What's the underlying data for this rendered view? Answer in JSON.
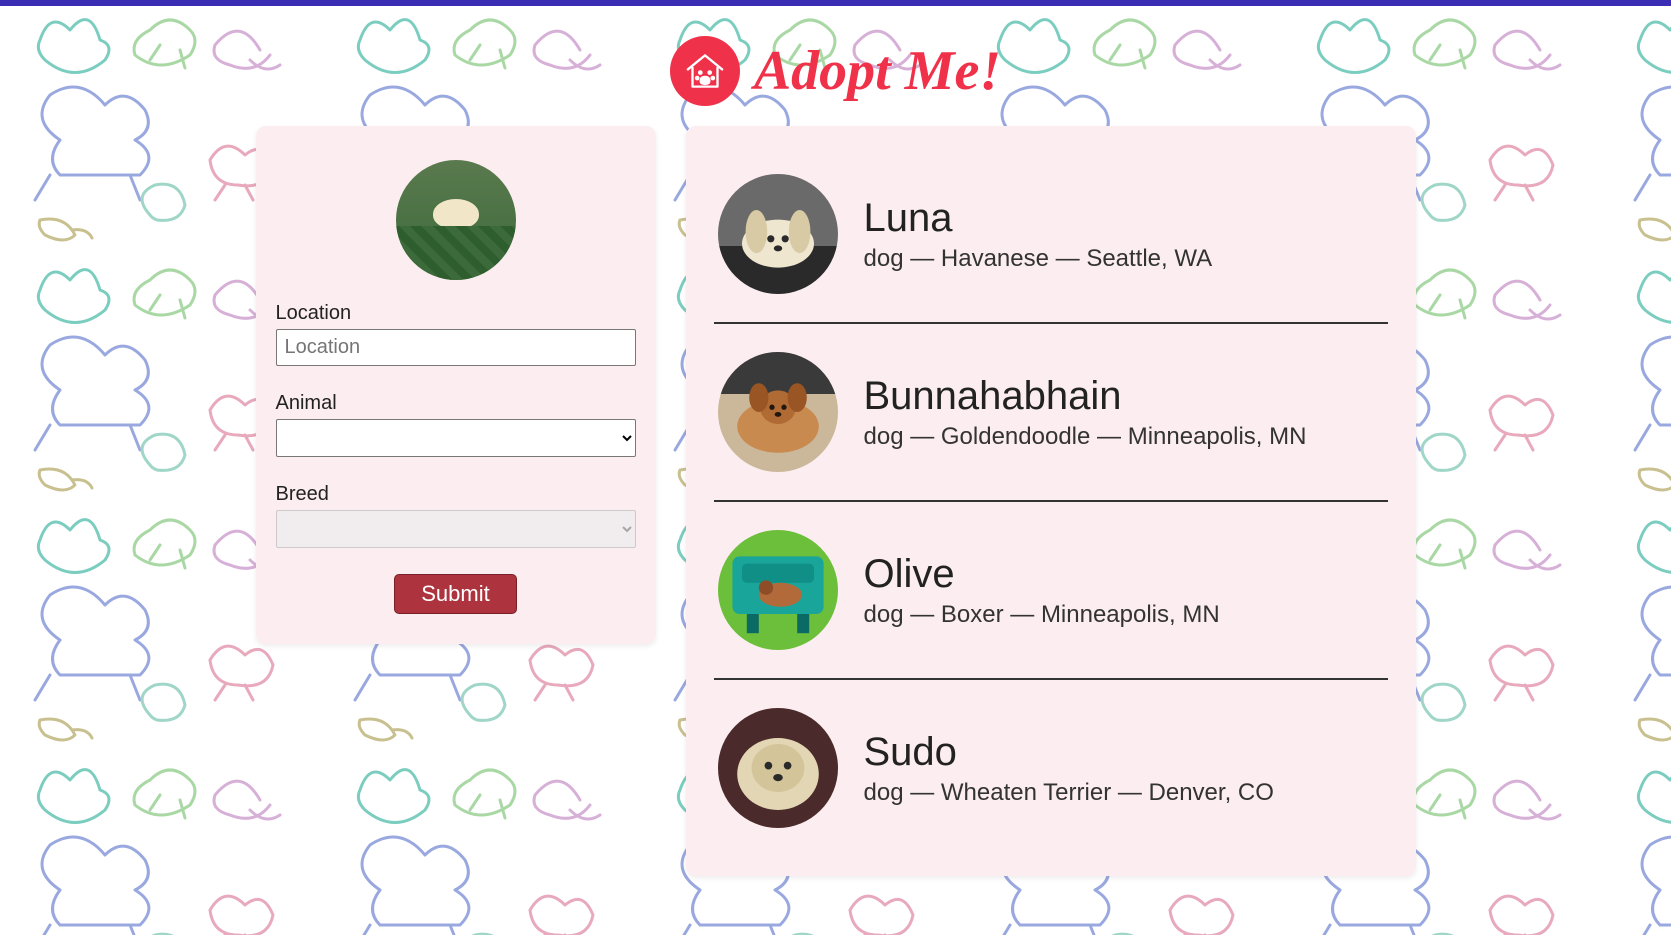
{
  "header": {
    "title": "Adopt Me!"
  },
  "search": {
    "location_label": "Location",
    "location_placeholder": "Location",
    "location_value": "",
    "animal_label": "Animal",
    "animal_value": "",
    "breed_label": "Breed",
    "breed_value": "",
    "submit_label": "Submit"
  },
  "results": [
    {
      "name": "Luna",
      "animal": "dog",
      "breed": "Havanese",
      "location": "Seattle, WA"
    },
    {
      "name": "Bunnahabhain",
      "animal": "dog",
      "breed": "Goldendoodle",
      "location": "Minneapolis, MN"
    },
    {
      "name": "Olive",
      "animal": "dog",
      "breed": "Boxer",
      "location": "Minneapolis, MN"
    },
    {
      "name": "Sudo",
      "animal": "dog",
      "breed": "Wheaten Terrier",
      "location": "Denver, CO"
    }
  ]
}
